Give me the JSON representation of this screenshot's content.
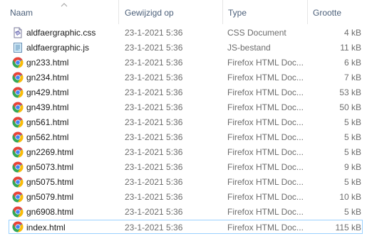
{
  "columns": {
    "name": "Naam",
    "date": "Gewijzigd op",
    "type": "Type",
    "size": "Grootte"
  },
  "files": [
    {
      "name": "aldfaergraphic.css",
      "date": "23-1-2021 5:36",
      "type": "CSS Document",
      "size": "4 kB",
      "icon": "css-file-icon"
    },
    {
      "name": "aldfaergraphic.js",
      "date": "23-1-2021 5:36",
      "type": "JS-bestand",
      "size": "11 kB",
      "icon": "js-file-icon"
    },
    {
      "name": "gn233.html",
      "date": "23-1-2021 5:36",
      "type": "Firefox HTML Doc...",
      "size": "6 kB",
      "icon": "chrome-icon"
    },
    {
      "name": "gn234.html",
      "date": "23-1-2021 5:36",
      "type": "Firefox HTML Doc...",
      "size": "7 kB",
      "icon": "chrome-icon"
    },
    {
      "name": "gn429.html",
      "date": "23-1-2021 5:36",
      "type": "Firefox HTML Doc...",
      "size": "53 kB",
      "icon": "chrome-icon"
    },
    {
      "name": "gn439.html",
      "date": "23-1-2021 5:36",
      "type": "Firefox HTML Doc...",
      "size": "50 kB",
      "icon": "chrome-icon"
    },
    {
      "name": "gn561.html",
      "date": "23-1-2021 5:36",
      "type": "Firefox HTML Doc...",
      "size": "5 kB",
      "icon": "chrome-icon"
    },
    {
      "name": "gn562.html",
      "date": "23-1-2021 5:36",
      "type": "Firefox HTML Doc...",
      "size": "5 kB",
      "icon": "chrome-icon"
    },
    {
      "name": "gn2269.html",
      "date": "23-1-2021 5:36",
      "type": "Firefox HTML Doc...",
      "size": "5 kB",
      "icon": "chrome-icon"
    },
    {
      "name": "gn5073.html",
      "date": "23-1-2021 5:36",
      "type": "Firefox HTML Doc...",
      "size": "9 kB",
      "icon": "chrome-icon"
    },
    {
      "name": "gn5075.html",
      "date": "23-1-2021 5:36",
      "type": "Firefox HTML Doc...",
      "size": "5 kB",
      "icon": "chrome-icon"
    },
    {
      "name": "gn5079.html",
      "date": "23-1-2021 5:36",
      "type": "Firefox HTML Doc...",
      "size": "10 kB",
      "icon": "chrome-icon"
    },
    {
      "name": "gn6908.html",
      "date": "23-1-2021 5:36",
      "type": "Firefox HTML Doc...",
      "size": "5 kB",
      "icon": "chrome-icon"
    },
    {
      "name": "index.html",
      "date": "23-1-2021 5:36",
      "type": "Firefox HTML Doc...",
      "size": "115 kB",
      "icon": "chrome-icon",
      "selected": true
    }
  ],
  "colors": {
    "header_text": "#4c607a",
    "selection_border": "#99d1ff",
    "secondary_text": "#6d6d6d"
  }
}
